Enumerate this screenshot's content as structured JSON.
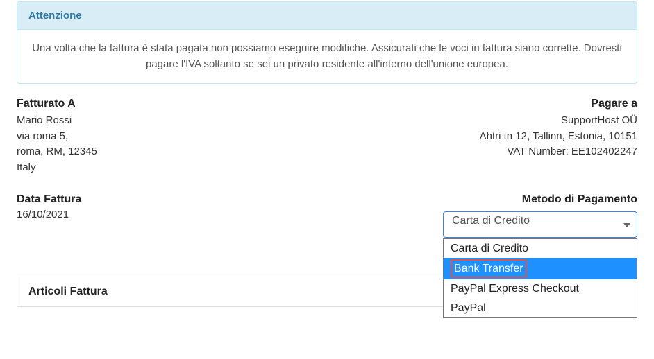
{
  "alert": {
    "title": "Attenzione",
    "body": "Una volta che la fattura è stata pagata non possiamo eseguire modifiche. Assicurati che le voci in fattura siano corrette. Dovresti pagare l'IVA soltanto se sei un privato residente all'interno dell'unione europea."
  },
  "billTo": {
    "title": "Fatturato A",
    "name": "Mario Rossi",
    "street": "via roma 5,",
    "cityline": "roma, RM, 12345",
    "country": "Italy"
  },
  "payTo": {
    "title": "Pagare a",
    "company": "SupportHost OÜ",
    "address": "Ahtri tn 12, Tallinn, Estonia, 10151",
    "vat": "VAT Number: EE102402247"
  },
  "invoiceDate": {
    "title": "Data Fattura",
    "value": "16/10/2021"
  },
  "paymentMethod": {
    "title": "Metodo di Pagamento",
    "selected": "Carta di Credito",
    "options": {
      "opt0": "Carta di Credito",
      "opt1": "Bank Transfer",
      "opt2": "PayPal Express Checkout",
      "opt3": "PayPal"
    }
  },
  "articles": {
    "title": "Articoli Fattura"
  }
}
